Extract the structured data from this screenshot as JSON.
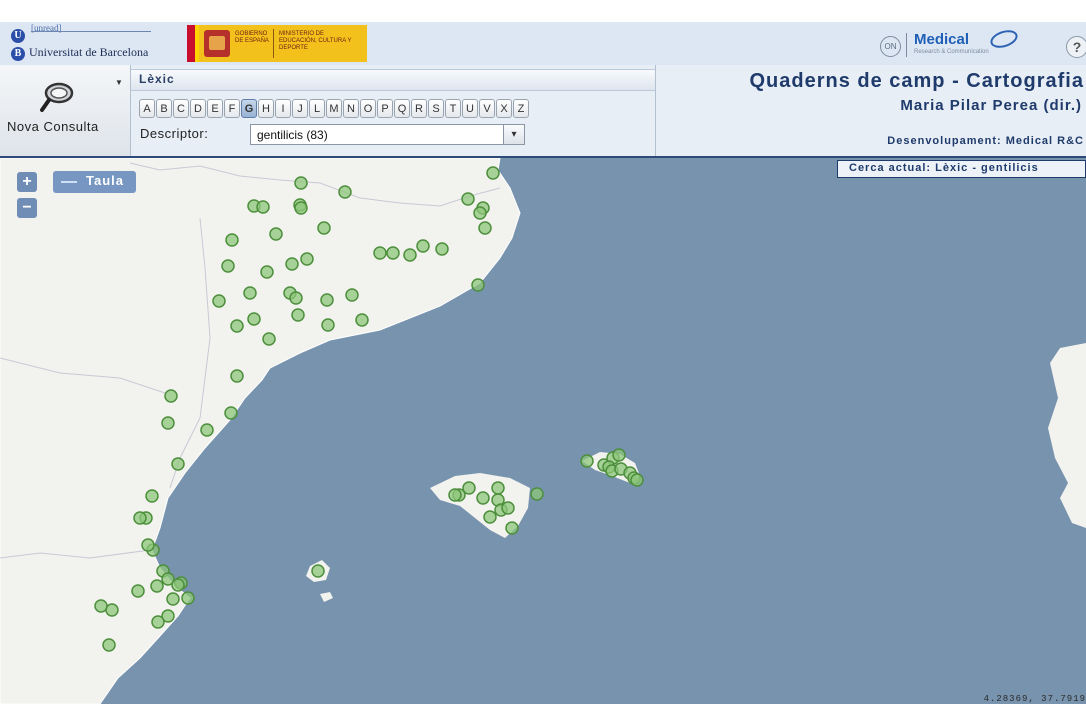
{
  "header": {
    "ub_wordmark": "[unread]",
    "ub_name": "Universitat de Barcelona",
    "gov_line1": "GOBIERNO DE ESPAÑA",
    "gov_line2": "MINISTERIO DE EDUCACIÓN, CULTURA Y DEPORTE",
    "on_badge": "ON",
    "medical_brand": "Medical",
    "medical_sub": "Research & Communication",
    "help_label": "?"
  },
  "toolbar": {
    "nova_consulta": "Nova Consulta",
    "section_title": "Lèxic",
    "letters": [
      "A",
      "B",
      "C",
      "D",
      "E",
      "F",
      "G",
      "H",
      "I",
      "J",
      "L",
      "M",
      "N",
      "O",
      "P",
      "Q",
      "R",
      "S",
      "T",
      "U",
      "V",
      "X",
      "Z"
    ],
    "active_letter": "G",
    "descriptor_label": "Descriptor:",
    "descriptor_value": "gentilicis (83)"
  },
  "title": {
    "main": "Quaderns de camp - Cartografia",
    "author": "Maria Pilar Perea (dir.)",
    "developer": "Desenvolupament: Medical R&C"
  },
  "map": {
    "zoom_in": "+",
    "zoom_out": "−",
    "table_button": "Taula",
    "current_search": "Cerca actual: Lèxic - gentilicis",
    "coordinates": "4.28369, 37.7919",
    "sea_color": "#7793ad",
    "land_color": "#f2f2ef",
    "marker_fill": "#8cc57a",
    "marker_stroke": "#4d8f3c"
  }
}
